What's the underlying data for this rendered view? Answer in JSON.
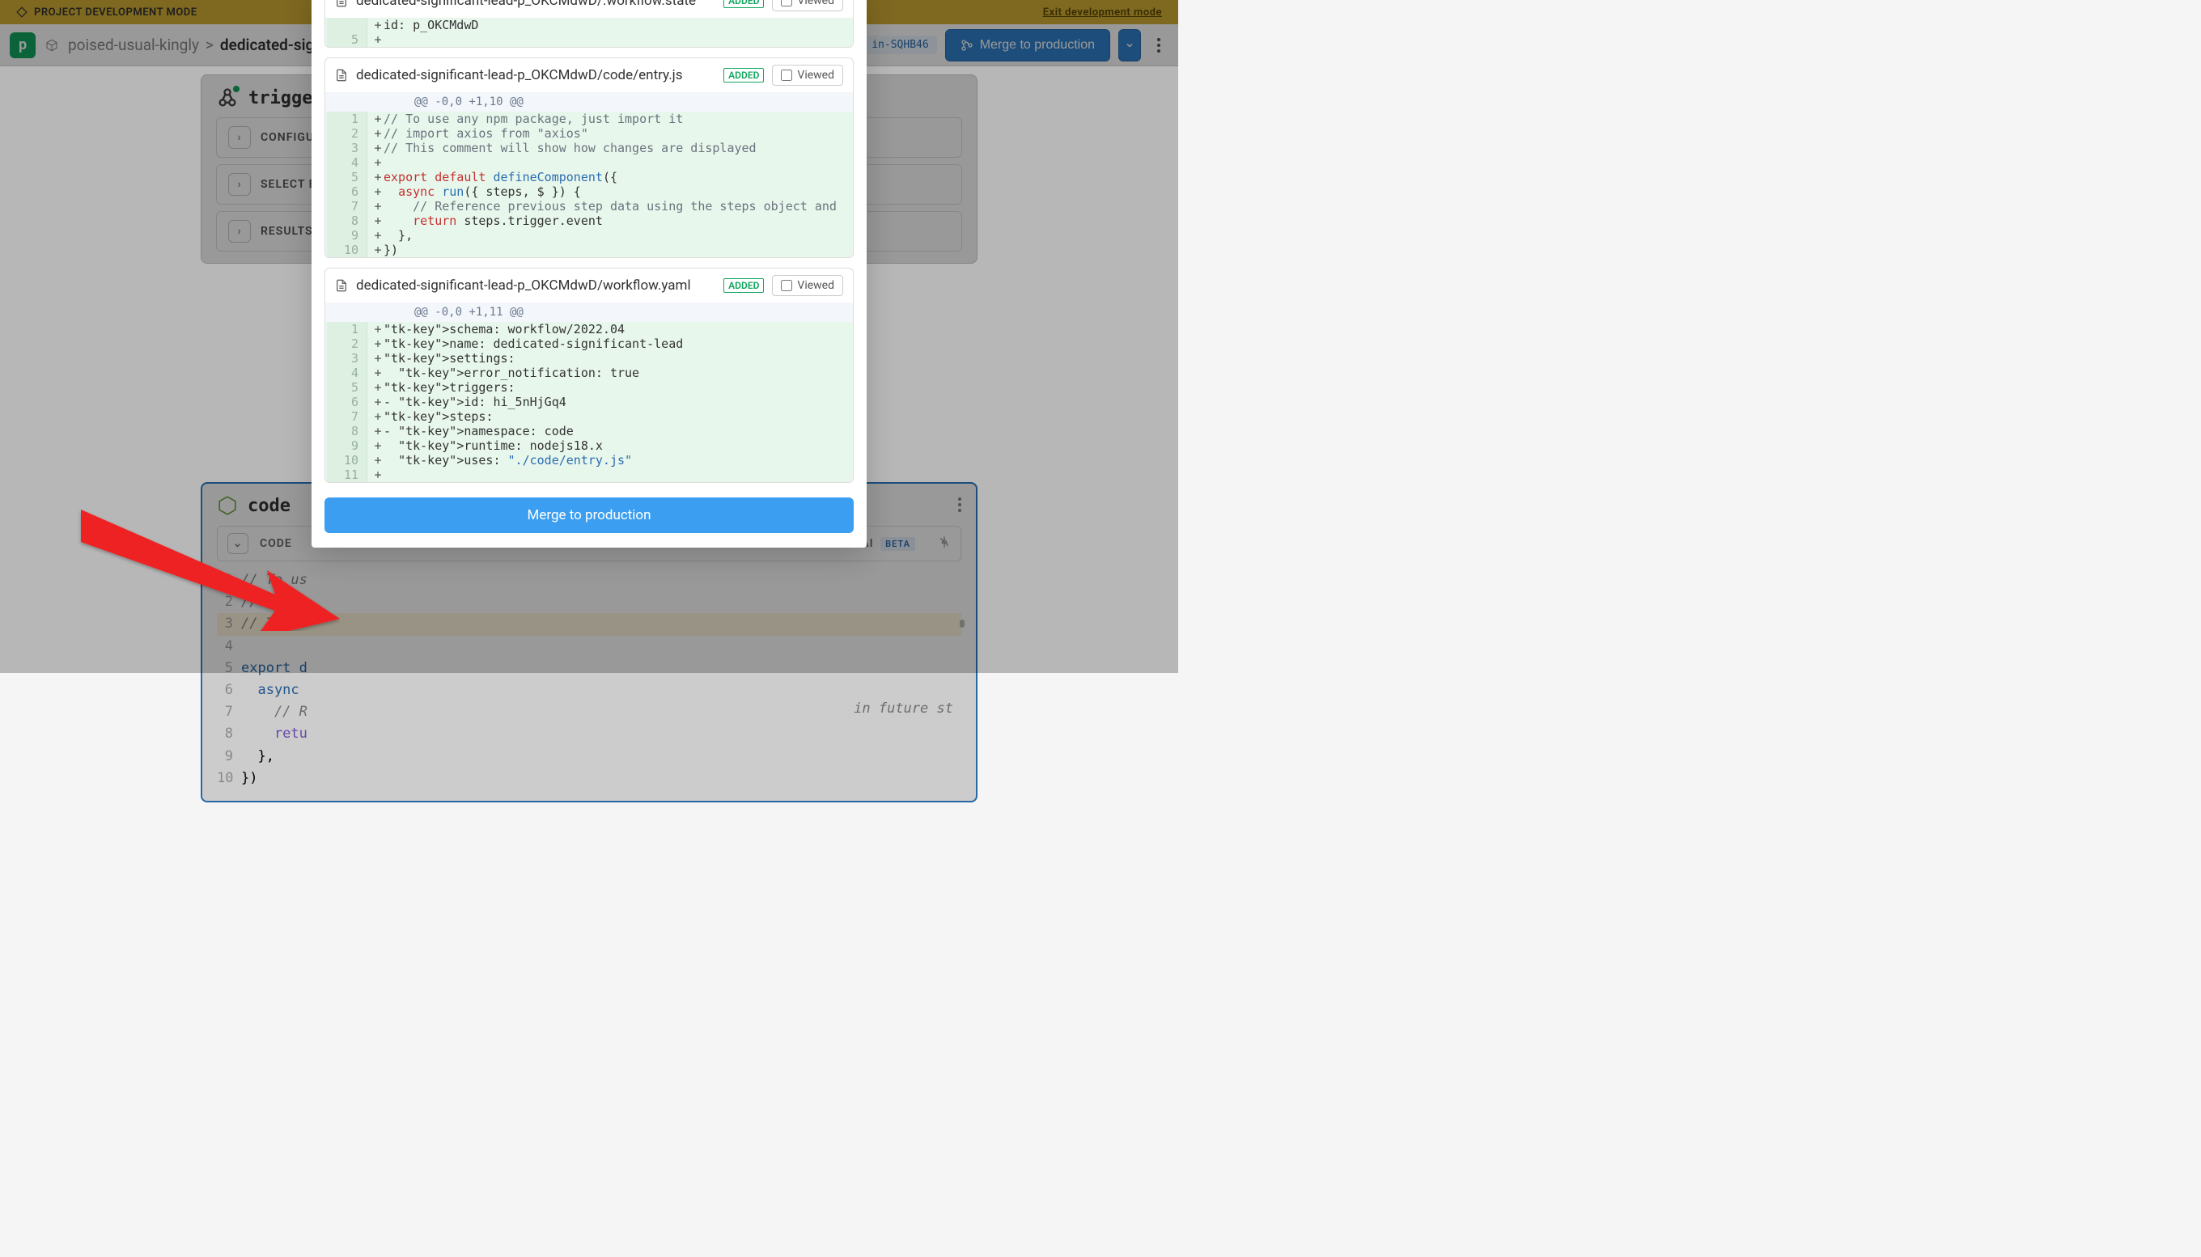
{
  "banner": {
    "label": "PROJECT DEVELOPMENT MODE",
    "exit": "Exit development mode"
  },
  "breadcrumb": {
    "parent": "poised-usual-kingly",
    "sep": ">",
    "current": "dedicated-sign"
  },
  "header": {
    "pill": "in-SQHB46",
    "merge": "Merge to production"
  },
  "trigger": {
    "title": "trigger",
    "rows": {
      "configure": "CONFIGURE",
      "select": "SELECT EVE",
      "results": "RESULTS"
    }
  },
  "code_card": {
    "title": "code",
    "tab": "CODE",
    "ai_label": "ith AI",
    "beta": "BETA"
  },
  "editor_lines": [
    {
      "n": 1,
      "t": "// To us",
      "cls": "cmnt"
    },
    {
      "n": 2,
      "t": "// impor",
      "cls": "cmnt"
    },
    {
      "n": 3,
      "t": "// This ",
      "cls": "cmnt hl"
    },
    {
      "n": 4,
      "t": "",
      "cls": ""
    },
    {
      "n": 5,
      "t": "export d",
      "cls": "kw-blue"
    },
    {
      "n": 6,
      "t": "  async ",
      "cls": "kw-blue"
    },
    {
      "n": 7,
      "t": "    // R",
      "cls": "cmnt"
    },
    {
      "n": 8,
      "t": "    retu",
      "cls": "kw-purple"
    },
    {
      "n": 9,
      "t": "  },",
      "cls": ""
    },
    {
      "n": 10,
      "t": "})",
      "cls": ""
    }
  ],
  "editor_tail": "in future st",
  "modal": {
    "viewed_label": "Viewed",
    "added_label": "ADDED",
    "merge_label": "Merge to production",
    "files": [
      {
        "name": "dedicated-significant-lead-p_OKCMdwD/.workflow.state",
        "hunk": null,
        "lines": [
          {
            "n": "",
            "raw": "+ id: p_OKCMdwD"
          },
          {
            "n": 5,
            "raw": "+"
          }
        ]
      },
      {
        "name": "dedicated-significant-lead-p_OKCMdwD/code/entry.js",
        "hunk": "@@ -0,0 +1,10 @@",
        "lines": [
          {
            "n": 1,
            "raw": "+ // To use any npm package, just import it"
          },
          {
            "n": 2,
            "raw": "+ // import axios from \"axios\""
          },
          {
            "n": 3,
            "raw": "+ // This comment will show how changes are displayed"
          },
          {
            "n": 4,
            "raw": "+"
          },
          {
            "n": 5,
            "raw": "+ export default defineComponent({"
          },
          {
            "n": 6,
            "raw": "+   async run({ steps, $ }) {"
          },
          {
            "n": 7,
            "raw": "+     // Reference previous step data using the steps object and"
          },
          {
            "n": 8,
            "raw": "+     return steps.trigger.event"
          },
          {
            "n": 9,
            "raw": "+   },"
          },
          {
            "n": 10,
            "raw": "+ })"
          }
        ]
      },
      {
        "name": "dedicated-significant-lead-p_OKCMdwD/workflow.yaml",
        "hunk": "@@ -0,0 +1,11 @@",
        "lines": [
          {
            "n": 1,
            "raw": "+ schema: workflow/2022.04"
          },
          {
            "n": 2,
            "raw": "+ name: dedicated-significant-lead"
          },
          {
            "n": 3,
            "raw": "+ settings:"
          },
          {
            "n": 4,
            "raw": "+   error_notification: true"
          },
          {
            "n": 5,
            "raw": "+ triggers:"
          },
          {
            "n": 6,
            "raw": "+ - id: hi_5nHjGq4"
          },
          {
            "n": 7,
            "raw": "+ steps:"
          },
          {
            "n": 8,
            "raw": "+ - namespace: code"
          },
          {
            "n": 9,
            "raw": "+   runtime: nodejs18.x"
          },
          {
            "n": 10,
            "raw": "+   uses: \"./code/entry.js\""
          },
          {
            "n": 11,
            "raw": "+"
          }
        ]
      }
    ]
  },
  "chart_data": null
}
